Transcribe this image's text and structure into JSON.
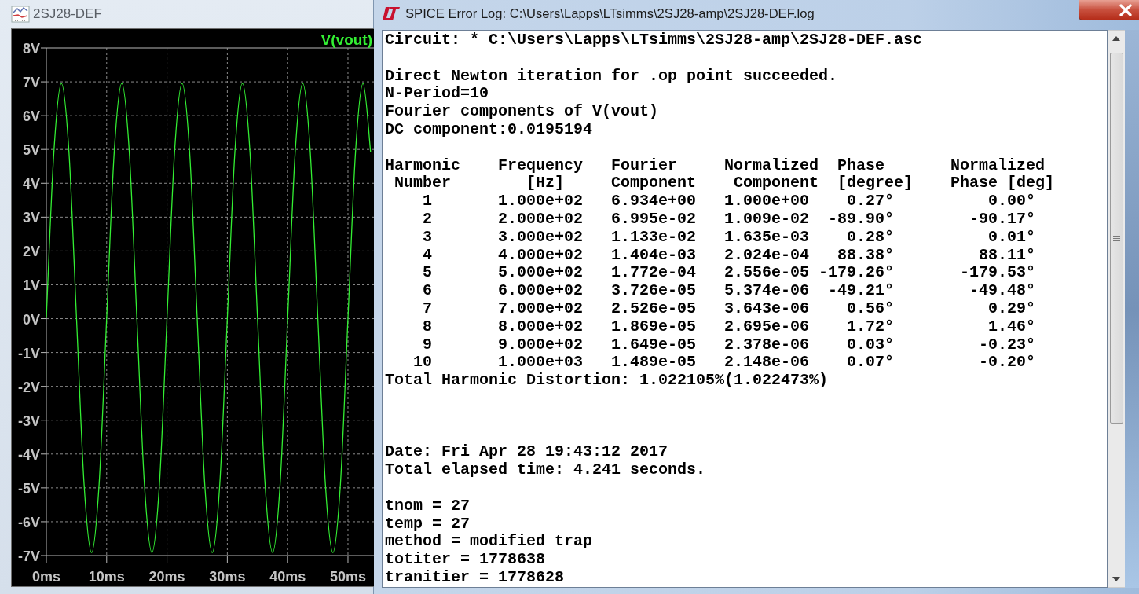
{
  "plot_window": {
    "title": "2SJ28-DEF",
    "chart_data": {
      "type": "line",
      "grid": true,
      "xlim": [
        0,
        54.3
      ],
      "ylim": [
        -7,
        8
      ],
      "x": [
        0,
        1.25,
        2.5,
        3.75,
        5,
        6.25,
        7.5,
        8.75,
        10,
        11.25,
        12.5,
        13.75,
        15,
        16.25,
        17.5,
        18.75,
        20,
        21.25,
        22.5,
        23.75,
        25,
        26.25,
        27.5,
        28.75,
        30,
        31.25,
        32.5,
        33.75,
        35,
        36.25,
        37.5,
        38.75,
        40,
        41.25,
        42.5,
        43.75,
        45,
        46.25,
        47.5,
        48.75,
        50,
        51.25,
        52.5,
        53.75
      ],
      "series": [
        {
          "name": "V(vout)",
          "color": "#33ee33",
          "values": [
            0.02,
            4.92,
            6.95,
            4.92,
            0.02,
            -4.88,
            -6.91,
            -4.88,
            0.02,
            4.92,
            6.95,
            4.92,
            0.02,
            -4.88,
            -6.91,
            -4.88,
            0.02,
            4.92,
            6.95,
            4.92,
            0.02,
            -4.88,
            -6.91,
            -4.88,
            0.02,
            4.92,
            6.95,
            4.92,
            0.02,
            -4.88,
            -6.91,
            -4.88,
            0.02,
            4.92,
            6.95,
            4.92,
            0.02,
            -4.88,
            -6.91,
            -4.88,
            0.02,
            4.92,
            6.95,
            4.92
          ]
        }
      ],
      "xticks": [
        {
          "value": 0,
          "label": "0ms"
        },
        {
          "value": 10,
          "label": "10ms"
        },
        {
          "value": 20,
          "label": "20ms"
        },
        {
          "value": 30,
          "label": "30ms"
        },
        {
          "value": 40,
          "label": "40ms"
        },
        {
          "value": 50,
          "label": "50ms"
        }
      ],
      "yticks": [
        {
          "value": 8,
          "label": "8V"
        },
        {
          "value": 7,
          "label": "7V"
        },
        {
          "value": 6,
          "label": "6V"
        },
        {
          "value": 5,
          "label": "5V"
        },
        {
          "value": 4,
          "label": "4V"
        },
        {
          "value": 3,
          "label": "3V"
        },
        {
          "value": 2,
          "label": "2V"
        },
        {
          "value": 1,
          "label": "1V"
        },
        {
          "value": 0,
          "label": "0V"
        },
        {
          "value": -1,
          "label": "-1V"
        },
        {
          "value": -2,
          "label": "-2V"
        },
        {
          "value": -3,
          "label": "-3V"
        },
        {
          "value": -4,
          "label": "-4V"
        },
        {
          "value": -5,
          "label": "-5V"
        },
        {
          "value": -6,
          "label": "-6V"
        },
        {
          "value": -7,
          "label": "-7V"
        }
      ]
    }
  },
  "log_window": {
    "title": "SPICE Error Log: C:\\Users\\Lapps\\LTsimms\\2SJ28-amp\\2SJ28-DEF.log",
    "circuit_line": "Circuit: * C:\\Users\\Lapps\\LTsimms\\2SJ28-amp\\2SJ28-DEF.asc",
    "intro_lines": [
      "Direct Newton iteration for .op point succeeded.",
      "N-Period=10",
      "Fourier components of V(vout)",
      "DC component:0.0195194"
    ],
    "fourier_table": {
      "columns": [
        "Harmonic\n Number",
        "Frequency\n   [Hz]",
        "Fourier\nComponent",
        "Normalized\n Component",
        "Phase\n[degree]",
        "Normalized\nPhase [deg]"
      ],
      "rows": [
        [
          "1",
          "1.000e+02",
          "6.934e+00",
          "1.000e+00",
          "0.27°",
          "0.00°"
        ],
        [
          "2",
          "2.000e+02",
          "6.995e-02",
          "1.009e-02",
          "-89.90°",
          "-90.17°"
        ],
        [
          "3",
          "3.000e+02",
          "1.133e-02",
          "1.635e-03",
          "0.28°",
          "0.01°"
        ],
        [
          "4",
          "4.000e+02",
          "1.404e-03",
          "2.024e-04",
          "88.38°",
          "88.11°"
        ],
        [
          "5",
          "5.000e+02",
          "1.772e-04",
          "2.556e-05",
          "-179.26°",
          "-179.53°"
        ],
        [
          "6",
          "6.000e+02",
          "3.726e-05",
          "5.374e-06",
          "-49.21°",
          "-49.48°"
        ],
        [
          "7",
          "7.000e+02",
          "2.526e-05",
          "3.643e-06",
          "0.56°",
          "0.29°"
        ],
        [
          "8",
          "8.000e+02",
          "1.869e-05",
          "2.695e-06",
          "1.72°",
          "1.46°"
        ],
        [
          "9",
          "9.000e+02",
          "1.649e-05",
          "2.378e-06",
          "0.03°",
          "-0.23°"
        ],
        [
          "10",
          "1.000e+03",
          "1.489e-05",
          "2.148e-06",
          "0.07°",
          "-0.20°"
        ]
      ]
    },
    "thd_line": "Total Harmonic Distortion: 1.022105%(1.022473%)",
    "run_lines": [
      "Date: Fri Apr 28 19:43:12 2017",
      "Total elapsed time: 4.241 seconds."
    ],
    "option_lines": [
      "tnom = 27",
      "temp = 27",
      "method = modified trap",
      "totiter = 1778638",
      "tranitier = 1778628"
    ]
  }
}
